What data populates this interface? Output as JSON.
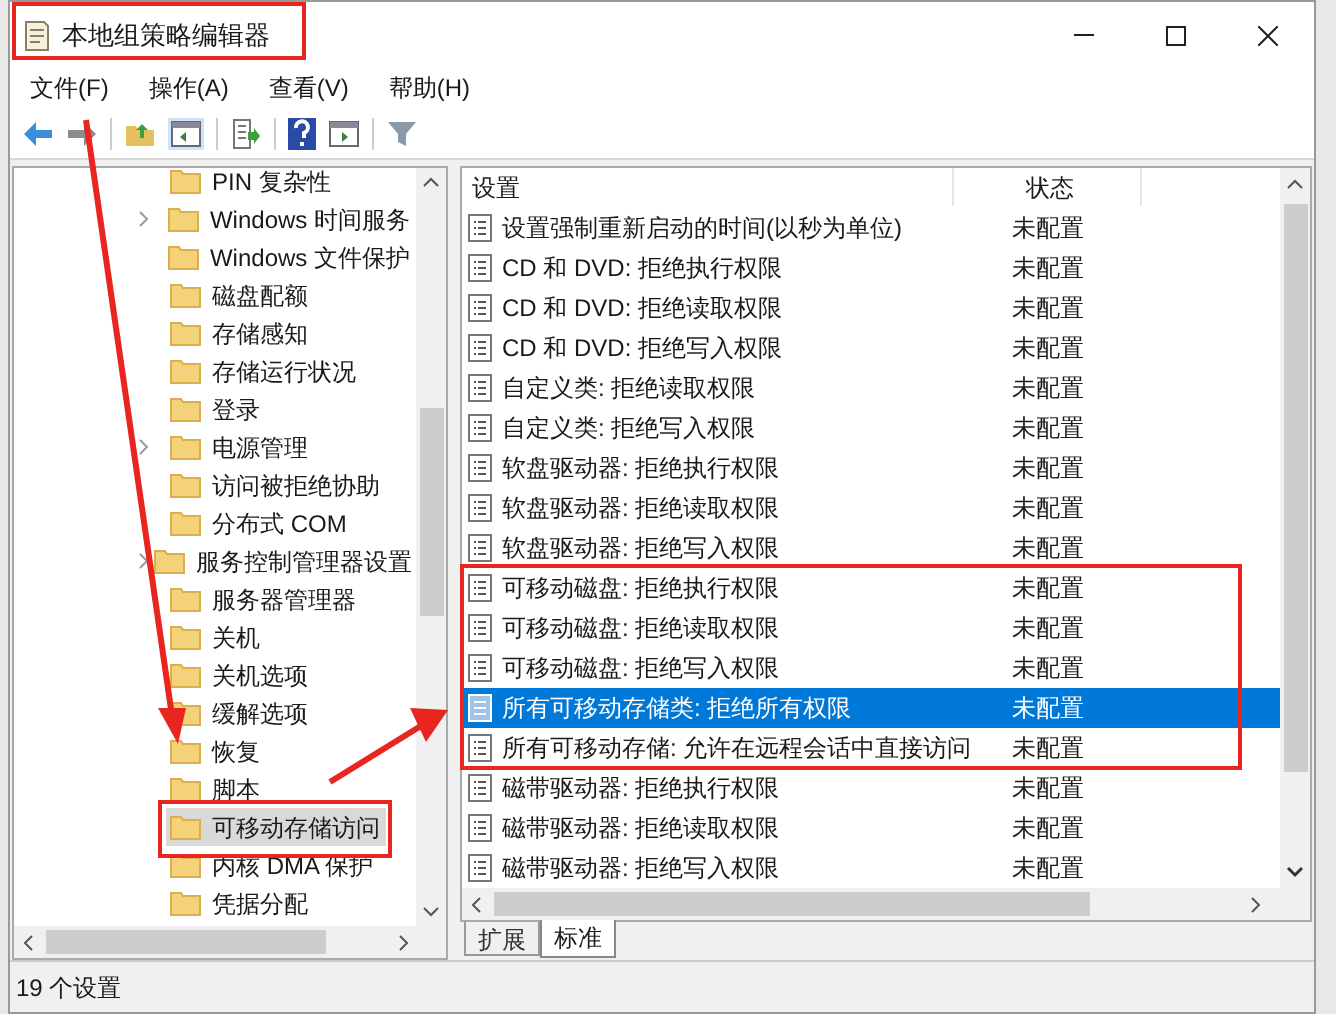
{
  "window": {
    "title": "本地组策略编辑器"
  },
  "menu": [
    "文件(F)",
    "操作(A)",
    "查看(V)",
    "帮助(H)"
  ],
  "tree": [
    {
      "label": "PIN 复杂性",
      "expandable": false,
      "selected": false
    },
    {
      "label": "Windows 时间服务",
      "expandable": true,
      "selected": false
    },
    {
      "label": "Windows 文件保护",
      "expandable": false,
      "selected": false
    },
    {
      "label": "磁盘配额",
      "expandable": false,
      "selected": false
    },
    {
      "label": "存储感知",
      "expandable": false,
      "selected": false
    },
    {
      "label": "存储运行状况",
      "expandable": false,
      "selected": false
    },
    {
      "label": "登录",
      "expandable": false,
      "selected": false
    },
    {
      "label": "电源管理",
      "expandable": true,
      "selected": false
    },
    {
      "label": "访问被拒绝协助",
      "expandable": false,
      "selected": false
    },
    {
      "label": "分布式 COM",
      "expandable": false,
      "selected": false
    },
    {
      "label": "服务控制管理器设置",
      "expandable": true,
      "selected": false
    },
    {
      "label": "服务器管理器",
      "expandable": false,
      "selected": false
    },
    {
      "label": "关机",
      "expandable": false,
      "selected": false
    },
    {
      "label": "关机选项",
      "expandable": false,
      "selected": false
    },
    {
      "label": "缓解选项",
      "expandable": false,
      "selected": false
    },
    {
      "label": "恢复",
      "expandable": false,
      "selected": false
    },
    {
      "label": "脚本",
      "expandable": false,
      "selected": false
    },
    {
      "label": "可移动存储访问",
      "expandable": false,
      "selected": true
    },
    {
      "label": "内核 DMA 保护",
      "expandable": false,
      "selected": false
    },
    {
      "label": "凭据分配",
      "expandable": false,
      "selected": false
    }
  ],
  "list": {
    "columns": [
      "设置",
      "状态"
    ],
    "rows": [
      {
        "name": "设置强制重新启动的时间(以秒为单位)",
        "state": "未配置",
        "selected": false
      },
      {
        "name": "CD 和 DVD: 拒绝执行权限",
        "state": "未配置",
        "selected": false
      },
      {
        "name": "CD 和 DVD: 拒绝读取权限",
        "state": "未配置",
        "selected": false
      },
      {
        "name": "CD 和 DVD: 拒绝写入权限",
        "state": "未配置",
        "selected": false
      },
      {
        "name": "自定义类: 拒绝读取权限",
        "state": "未配置",
        "selected": false
      },
      {
        "name": "自定义类: 拒绝写入权限",
        "state": "未配置",
        "selected": false
      },
      {
        "name": "软盘驱动器: 拒绝执行权限",
        "state": "未配置",
        "selected": false
      },
      {
        "name": "软盘驱动器: 拒绝读取权限",
        "state": "未配置",
        "selected": false
      },
      {
        "name": "软盘驱动器: 拒绝写入权限",
        "state": "未配置",
        "selected": false
      },
      {
        "name": "可移动磁盘: 拒绝执行权限",
        "state": "未配置",
        "selected": false
      },
      {
        "name": "可移动磁盘: 拒绝读取权限",
        "state": "未配置",
        "selected": false
      },
      {
        "name": "可移动磁盘: 拒绝写入权限",
        "state": "未配置",
        "selected": false
      },
      {
        "name": "所有可移动存储类: 拒绝所有权限",
        "state": "未配置",
        "selected": true
      },
      {
        "name": "所有可移动存储: 允许在远程会话中直接访问",
        "state": "未配置",
        "selected": false
      },
      {
        "name": "磁带驱动器: 拒绝执行权限",
        "state": "未配置",
        "selected": false
      },
      {
        "name": "磁带驱动器: 拒绝读取权限",
        "state": "未配置",
        "selected": false
      },
      {
        "name": "磁带驱动器: 拒绝写入权限",
        "state": "未配置",
        "selected": false
      }
    ]
  },
  "tabs": [
    {
      "label": "扩展",
      "selected": false
    },
    {
      "label": "标准",
      "selected": true
    }
  ],
  "status_bar": "19 个设置"
}
